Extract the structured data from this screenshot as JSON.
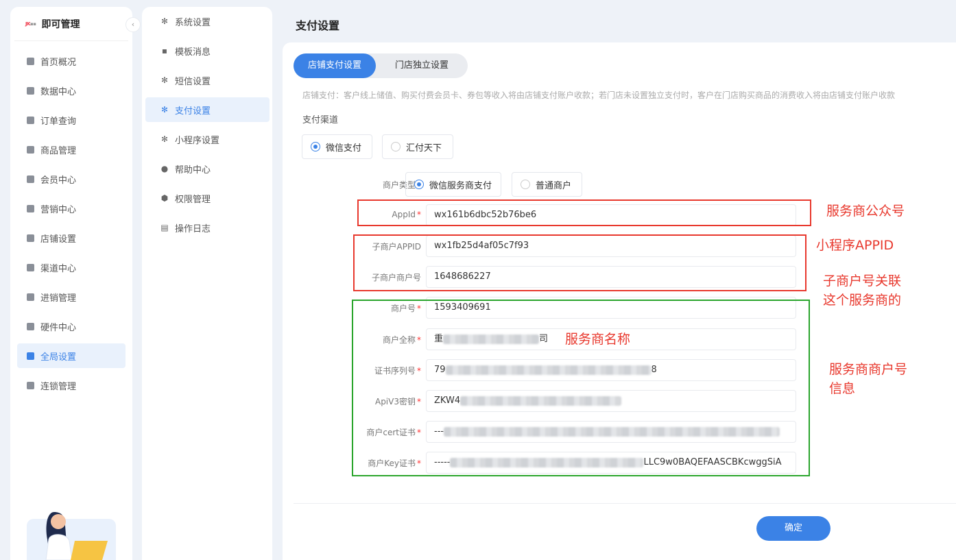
{
  "brand": {
    "logo_text": "JK",
    "name": "即可管理"
  },
  "leftnav": [
    {
      "label": "首页概况",
      "icon": "grid-icon"
    },
    {
      "label": "数据中心",
      "icon": "bar-chart-icon"
    },
    {
      "label": "订单查询",
      "icon": "calendar-icon"
    },
    {
      "label": "商品管理",
      "icon": "bag-icon"
    },
    {
      "label": "会员中心",
      "icon": "crown-icon"
    },
    {
      "label": "营销中心",
      "icon": "gift-icon"
    },
    {
      "label": "店铺设置",
      "icon": "store-icon"
    },
    {
      "label": "渠道中心",
      "icon": "channel-icon"
    },
    {
      "label": "进销管理",
      "icon": "inventory-icon"
    },
    {
      "label": "硬件中心",
      "icon": "hardware-icon"
    },
    {
      "label": "全局设置",
      "icon": "gear-icon",
      "active": true
    },
    {
      "label": "连锁管理",
      "icon": "chain-icon"
    }
  ],
  "subnav": [
    {
      "label": "系统设置",
      "icon": "gear-icon"
    },
    {
      "label": "模板消息",
      "icon": "message-icon"
    },
    {
      "label": "短信设置",
      "icon": "gear-icon"
    },
    {
      "label": "支付设置",
      "icon": "gear-icon",
      "active": true
    },
    {
      "label": "小程序设置",
      "icon": "gear-icon"
    },
    {
      "label": "帮助中心",
      "icon": "help-icon"
    },
    {
      "label": "权限管理",
      "icon": "shield-icon"
    },
    {
      "label": "操作日志",
      "icon": "log-icon"
    }
  ],
  "page": {
    "title": "支付设置",
    "tabs": [
      "店铺支付设置",
      "门店独立设置"
    ],
    "description": "店铺支付：客户线上储值、购买付费会员卡、券包等收入将由店铺支付账户收款；若门店未设置独立支付时，客户在门店购买商品的消费收入将由店铺支付账户收款",
    "channel_label": "支付渠道",
    "channels": [
      "微信支付",
      "汇付天下"
    ],
    "selected_channel": "微信支付",
    "merchant_type_label": "商户类型",
    "merchant_types": [
      "微信服务商支付",
      "普通商户"
    ],
    "selected_merchant_type": "微信服务商支付",
    "fields": {
      "appid": {
        "label": "AppId",
        "value": "wx161b6dbc52b76be6",
        "required": true
      },
      "sub_appid": {
        "label": "子商户APPID",
        "value": "wx1fb25d4af05c7f93",
        "required": false
      },
      "sub_mchid": {
        "label": "子商户商户号",
        "value": "1648686227",
        "required": false
      },
      "mchid": {
        "label": "商户号",
        "value": "1593409691",
        "required": true
      },
      "merchant_name": {
        "label": "商户全称",
        "value_prefix": "重",
        "value_suffix": "司",
        "required": true
      },
      "cert_serial": {
        "label": "证书序列号",
        "value_prefix": "79",
        "value_suffix": "8",
        "required": true
      },
      "apiv3_key": {
        "label": "ApiV3密钥",
        "value_prefix": "ZKW4",
        "required": true
      },
      "cert": {
        "label": "商户cert证书",
        "value_prefix": "---",
        "required": true
      },
      "key_cert": {
        "label": "商户Key证书",
        "value_prefix": "-----",
        "value_suffix": "LLC9w0BAQEFAASCBKcwggSiA",
        "required": true
      }
    },
    "required_mark": "*",
    "confirm_label": "确定"
  },
  "annotations": {
    "appid_note": "服务商公众号",
    "sub_appid_note": "小程序APPID",
    "sub_mchid_note_line1": "子商户号关联",
    "sub_mchid_note_line2": "这个服务商的",
    "merchant_name_note": "服务商名称",
    "merchant_info_note_line1": "服务商商户号",
    "merchant_info_note_line2": "信息",
    "colors": {
      "red": "#e8382d",
      "green": "#2aa52c"
    }
  },
  "theme": {
    "accent": "#3b82e6"
  }
}
